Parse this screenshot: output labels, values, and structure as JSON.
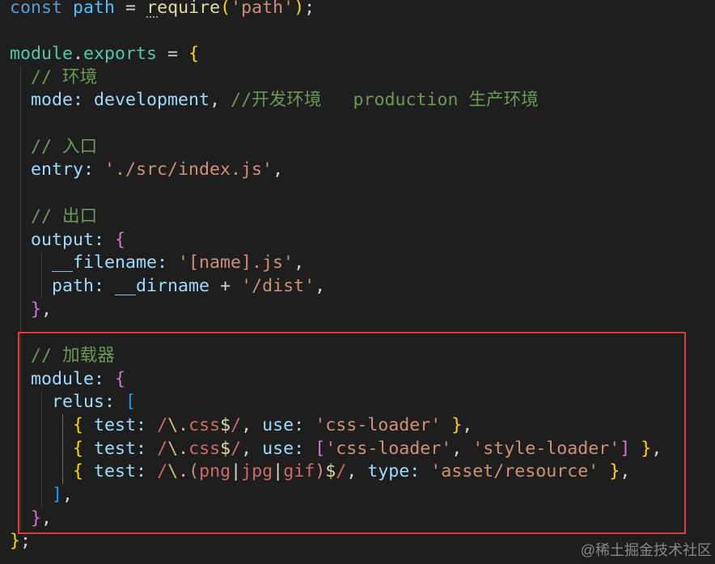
{
  "theme": {
    "background": "#1e1e1e",
    "indent_guide": "#404040",
    "indent_guide_active": "#707070"
  },
  "highlight_box": {
    "border_color": "#e53935"
  },
  "watermark": "@稀土掘金技术社区",
  "editor": {
    "lines": [
      {
        "tokens": [
          {
            "t": "const",
            "c": "#569cd6"
          },
          {
            "t": " "
          },
          {
            "t": "path",
            "c": "#4fc1ff"
          },
          {
            "t": " = ",
            "c": "#d4d4d4"
          },
          {
            "t": "require",
            "c": "#dcdcaa"
          },
          {
            "t": "(",
            "c": "#ffd700"
          },
          {
            "t": "'path'",
            "c": "#ce9178"
          },
          {
            "t": ")",
            "c": "#ffd700"
          },
          {
            "t": ";",
            "c": "#d4d4d4"
          }
        ]
      },
      {
        "tokens": []
      },
      {
        "tokens": [
          {
            "t": "module",
            "c": "#4ec9b0"
          },
          {
            "t": ".",
            "c": "#d4d4d4"
          },
          {
            "t": "exports",
            "c": "#4ec9b0"
          },
          {
            "t": " = ",
            "c": "#d4d4d4"
          },
          {
            "t": "{",
            "c": "#ffd700"
          }
        ]
      },
      {
        "tokens": [
          {
            "t": "  "
          },
          {
            "t": "// 环境",
            "c": "#6a9955"
          }
        ]
      },
      {
        "tokens": [
          {
            "t": "  "
          },
          {
            "t": "mode:",
            "c": "#9cdcfe"
          },
          {
            "t": " "
          },
          {
            "t": "development",
            "c": "#9cdcfe"
          },
          {
            "t": ", ",
            "c": "#d4d4d4"
          },
          {
            "t": "//开发环境   production 生产环境",
            "c": "#6a9955"
          }
        ]
      },
      {
        "tokens": []
      },
      {
        "tokens": [
          {
            "t": "  "
          },
          {
            "t": "// 入口",
            "c": "#6a9955"
          }
        ]
      },
      {
        "tokens": [
          {
            "t": "  "
          },
          {
            "t": "entry:",
            "c": "#9cdcfe"
          },
          {
            "t": " "
          },
          {
            "t": "'./src/index.js'",
            "c": "#ce9178"
          },
          {
            "t": ",",
            "c": "#d4d4d4"
          }
        ]
      },
      {
        "tokens": []
      },
      {
        "tokens": [
          {
            "t": "  "
          },
          {
            "t": "// 出口",
            "c": "#6a9955"
          }
        ]
      },
      {
        "tokens": [
          {
            "t": "  "
          },
          {
            "t": "output:",
            "c": "#9cdcfe"
          },
          {
            "t": " "
          },
          {
            "t": "{",
            "c": "#da70d6"
          }
        ]
      },
      {
        "tokens": [
          {
            "t": "    "
          },
          {
            "t": "__filename:",
            "c": "#9cdcfe"
          },
          {
            "t": " "
          },
          {
            "t": "'[name].js'",
            "c": "#ce9178"
          },
          {
            "t": ",",
            "c": "#d4d4d4"
          }
        ]
      },
      {
        "tokens": [
          {
            "t": "    "
          },
          {
            "t": "path:",
            "c": "#9cdcfe"
          },
          {
            "t": " "
          },
          {
            "t": "__dirname",
            "c": "#9cdcfe"
          },
          {
            "t": " + ",
            "c": "#d4d4d4"
          },
          {
            "t": "'/dist'",
            "c": "#ce9178"
          },
          {
            "t": ",",
            "c": "#d4d4d4"
          }
        ]
      },
      {
        "tokens": [
          {
            "t": "  "
          },
          {
            "t": "}",
            "c": "#da70d6"
          },
          {
            "t": ",",
            "c": "#d4d4d4"
          }
        ]
      },
      {
        "tokens": []
      },
      {
        "tokens": [
          {
            "t": "  "
          },
          {
            "t": "// 加载器",
            "c": "#6a9955"
          }
        ]
      },
      {
        "tokens": [
          {
            "t": "  "
          },
          {
            "t": "module:",
            "c": "#9cdcfe"
          },
          {
            "t": " "
          },
          {
            "t": "{",
            "c": "#da70d6"
          }
        ]
      },
      {
        "tokens": [
          {
            "t": "    "
          },
          {
            "t": "relus:",
            "c": "#9cdcfe"
          },
          {
            "t": " "
          },
          {
            "t": "[",
            "c": "#179fff"
          }
        ]
      },
      {
        "tokens": [
          {
            "t": "      "
          },
          {
            "t": "{",
            "c": "#ffd700"
          },
          {
            "t": " "
          },
          {
            "t": "test:",
            "c": "#9cdcfe"
          },
          {
            "t": " "
          },
          {
            "t": "/",
            "c": "#d16969"
          },
          {
            "t": "\\.",
            "c": "#d7ba7d"
          },
          {
            "t": "css",
            "c": "#d16969"
          },
          {
            "t": "$",
            "c": "#dcdcaa"
          },
          {
            "t": "/",
            "c": "#d16969"
          },
          {
            "t": ", ",
            "c": "#d4d4d4"
          },
          {
            "t": "use:",
            "c": "#9cdcfe"
          },
          {
            "t": " "
          },
          {
            "t": "'css-loader'",
            "c": "#ce9178"
          },
          {
            "t": " "
          },
          {
            "t": "}",
            "c": "#ffd700"
          },
          {
            "t": ",",
            "c": "#d4d4d4"
          }
        ]
      },
      {
        "tokens": [
          {
            "t": "      "
          },
          {
            "t": "{",
            "c": "#ffd700"
          },
          {
            "t": " "
          },
          {
            "t": "test:",
            "c": "#9cdcfe"
          },
          {
            "t": " "
          },
          {
            "t": "/",
            "c": "#d16969"
          },
          {
            "t": "\\.",
            "c": "#d7ba7d"
          },
          {
            "t": "css",
            "c": "#d16969"
          },
          {
            "t": "$",
            "c": "#dcdcaa"
          },
          {
            "t": "/",
            "c": "#d16969"
          },
          {
            "t": ", ",
            "c": "#d4d4d4"
          },
          {
            "t": "use:",
            "c": "#9cdcfe"
          },
          {
            "t": " "
          },
          {
            "t": "[",
            "c": "#da70d6"
          },
          {
            "t": "'css-loader'",
            "c": "#ce9178"
          },
          {
            "t": ", ",
            "c": "#d4d4d4"
          },
          {
            "t": "'style-loader'",
            "c": "#ce9178"
          },
          {
            "t": "]",
            "c": "#da70d6"
          },
          {
            "t": " "
          },
          {
            "t": "}",
            "c": "#ffd700"
          },
          {
            "t": ",",
            "c": "#d4d4d4"
          }
        ]
      },
      {
        "tokens": [
          {
            "t": "      "
          },
          {
            "t": "{",
            "c": "#ffd700"
          },
          {
            "t": " "
          },
          {
            "t": "test:",
            "c": "#9cdcfe"
          },
          {
            "t": " "
          },
          {
            "t": "/",
            "c": "#d16969"
          },
          {
            "t": "\\.",
            "c": "#d7ba7d"
          },
          {
            "t": "(",
            "c": "#ce9178"
          },
          {
            "t": "png",
            "c": "#d16969"
          },
          {
            "t": "|",
            "c": "#dcdcaa"
          },
          {
            "t": "jpg",
            "c": "#d16969"
          },
          {
            "t": "|",
            "c": "#dcdcaa"
          },
          {
            "t": "gif",
            "c": "#d16969"
          },
          {
            "t": ")",
            "c": "#ce9178"
          },
          {
            "t": "$",
            "c": "#dcdcaa"
          },
          {
            "t": "/",
            "c": "#d16969"
          },
          {
            "t": ", ",
            "c": "#d4d4d4"
          },
          {
            "t": "type:",
            "c": "#9cdcfe"
          },
          {
            "t": " "
          },
          {
            "t": "'asset/resource'",
            "c": "#ce9178"
          },
          {
            "t": " "
          },
          {
            "t": "}",
            "c": "#ffd700"
          },
          {
            "t": ",",
            "c": "#d4d4d4"
          }
        ]
      },
      {
        "tokens": [
          {
            "t": "    "
          },
          {
            "t": "]",
            "c": "#179fff"
          },
          {
            "t": ",",
            "c": "#d4d4d4"
          }
        ]
      },
      {
        "tokens": [
          {
            "t": "  "
          },
          {
            "t": "}",
            "c": "#da70d6"
          },
          {
            "t": ",",
            "c": "#d4d4d4"
          }
        ]
      },
      {
        "tokens": [
          {
            "t": "}",
            "c": "#ffd700"
          },
          {
            "t": ";",
            "c": "#d4d4d4"
          }
        ]
      }
    ]
  }
}
